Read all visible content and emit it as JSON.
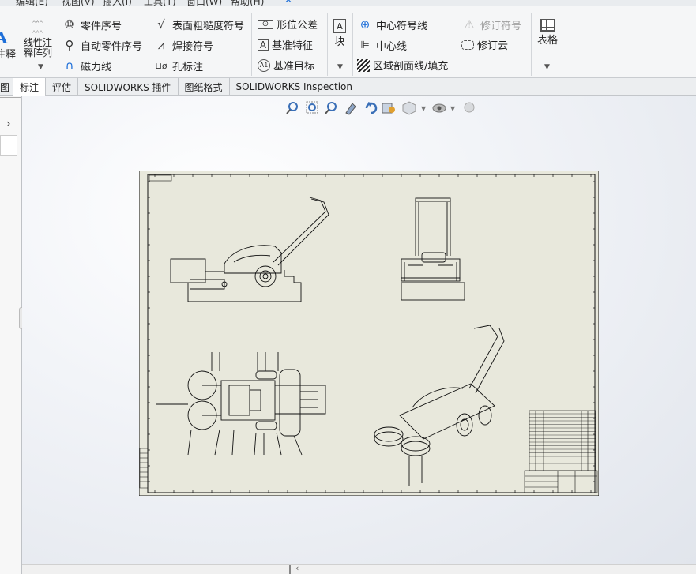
{
  "menu": [
    "编辑(E)",
    "视图(V)",
    "插入(I)",
    "工具(T)",
    "窗口(W)",
    "帮助(H)"
  ],
  "ribbon": {
    "annotation_big": "注释",
    "linear_note_pattern": [
      "线性注",
      "释阵列"
    ],
    "balloon": "零件序号",
    "auto_balloon": "自动零件序号",
    "magnetic_line": "磁力线",
    "surface_finish": "表面粗糙度符号",
    "weld_symbol": "焊接符号",
    "hole_callout": "孔标注",
    "geometric_tolerance": "形位公差",
    "datum_feature": "基准特征",
    "datum_target": "基准目标",
    "blocks": "块",
    "center_mark": "中心符号线",
    "centerline": "中心线",
    "area_hatch": "区域剖面线/填充",
    "revision_symbol": "修订符号",
    "revision_cloud": "修订云",
    "tables": "表格"
  },
  "tabs": [
    {
      "label": "图",
      "active": false
    },
    {
      "label": "标注",
      "active": true
    },
    {
      "label": "评估",
      "active": false
    },
    {
      "label": "SOLIDWORKS 插件",
      "active": false
    },
    {
      "label": "图纸格式",
      "active": false
    },
    {
      "label": "SOLIDWORKS Inspection",
      "active": false
    }
  ],
  "colors": {
    "sheet": "#e8e8dc",
    "accent": "#1e6fd9",
    "line": "#111111"
  },
  "view_toolbar_icons": [
    "zoom-to-fit-icon",
    "zoom-to-area-icon",
    "zoom-in-out-icon",
    "pan-icon",
    "rotate-icon",
    "section-view-icon",
    "display-style-icon",
    "hide-show-icon",
    "appearance-icon"
  ]
}
